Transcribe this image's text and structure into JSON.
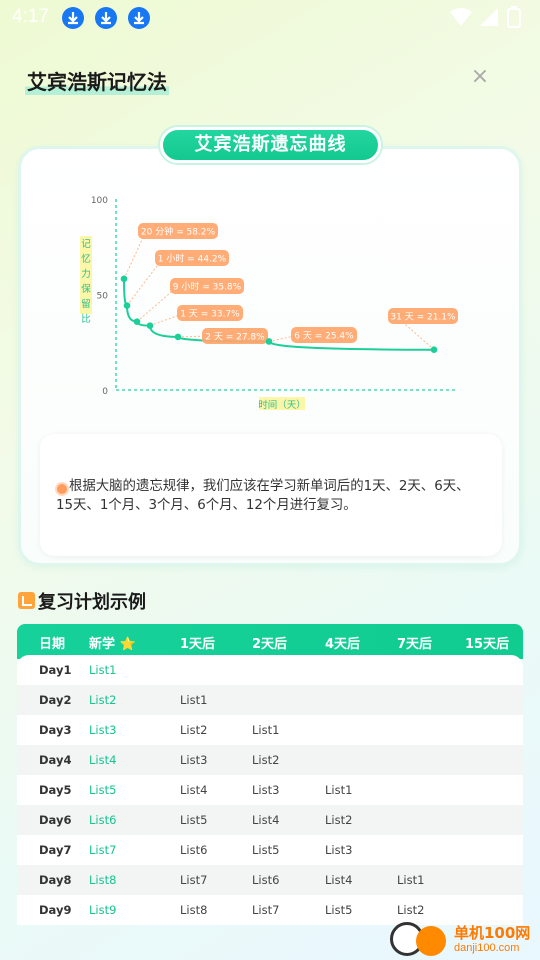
{
  "status_bar": {
    "time": "4:17",
    "download_icons": 3
  },
  "header": {
    "title": "艾宾浩斯记忆法",
    "close_glyph": "×"
  },
  "curve_card": {
    "pill_title": "艾宾浩斯遗忘曲线",
    "info_text": "根据大脑的遗忘规律，我们应该在学习新单词后的1天、2天、6天、15天、1个月、3个月、6个月、12个月进行复习。"
  },
  "chart_data": {
    "type": "line",
    "title": "",
    "xlabel": "时间（天）",
    "ylabel": "记忆力保留比",
    "ylim": [
      0,
      100
    ],
    "yticks": [
      "100",
      "50",
      "0"
    ],
    "points": [
      {
        "label": "20 分钟 = 58.2%",
        "value": 58.2
      },
      {
        "label": "1 小时 = 44.2%",
        "value": 44.2
      },
      {
        "label": "9 小时 = 35.8%",
        "value": 35.8
      },
      {
        "label": "1 天 = 33.7%",
        "value": 33.7
      },
      {
        "label": "2 天 = 27.8%",
        "value": 27.8
      },
      {
        "label": "6 天 = 25.4%",
        "value": 25.4
      },
      {
        "label": "31 天 = 21.1%",
        "value": 21.1
      }
    ],
    "colors": {
      "curve": "#1ccf98",
      "label_bg": "#ffa56b",
      "axis": "#25d49c"
    }
  },
  "section": {
    "title": "复习计划示例"
  },
  "table": {
    "headers": [
      "日期",
      "新学 ⭐",
      "1天后",
      "2天后",
      "4天后",
      "7天后",
      "15天后"
    ],
    "rows": [
      [
        "Day1",
        "List1",
        "",
        "",
        "",
        "",
        ""
      ],
      [
        "Day2",
        "List2",
        "List1",
        "",
        "",
        "",
        ""
      ],
      [
        "Day3",
        "List3",
        "List2",
        "List1",
        "",
        "",
        ""
      ],
      [
        "Day4",
        "List4",
        "List3",
        "List2",
        "",
        "",
        ""
      ],
      [
        "Day5",
        "List5",
        "List4",
        "List3",
        "List1",
        "",
        ""
      ],
      [
        "Day6",
        "List6",
        "List5",
        "List4",
        "List2",
        "",
        ""
      ],
      [
        "Day7",
        "List7",
        "List6",
        "List5",
        "List3",
        "",
        ""
      ],
      [
        "Day8",
        "List8",
        "List7",
        "List6",
        "List4",
        "List1",
        ""
      ],
      [
        "Day9",
        "List9",
        "List8",
        "List7",
        "List5",
        "List2",
        ""
      ]
    ]
  },
  "watermark": {
    "name": "单机100网",
    "url": "danji100.com"
  }
}
